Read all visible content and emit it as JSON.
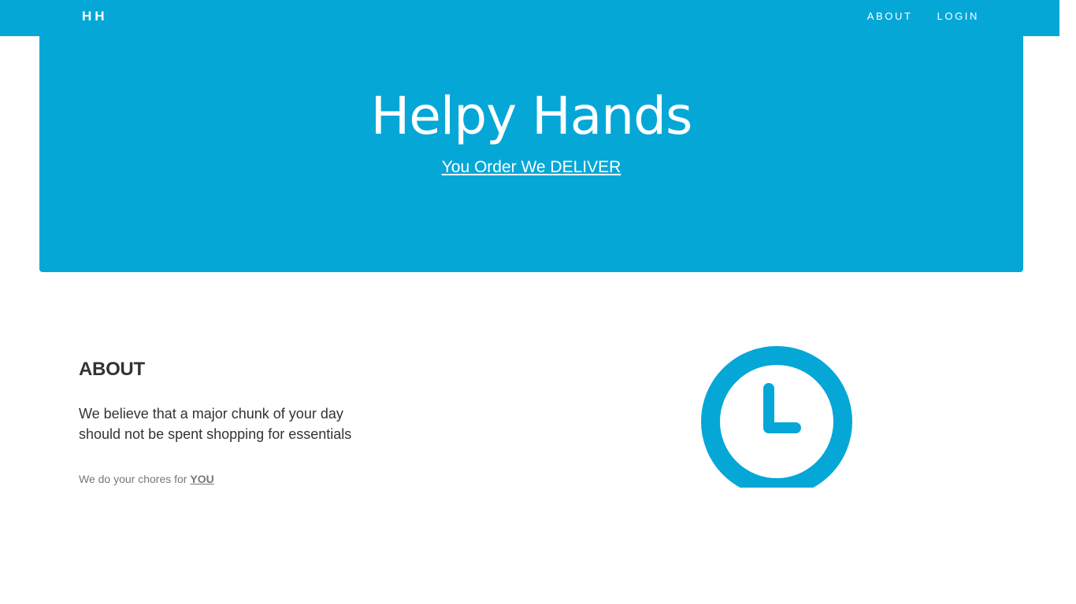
{
  "navbar": {
    "brand": "HH",
    "links": [
      {
        "label": "ABOUT"
      },
      {
        "label": "LOGIN"
      }
    ]
  },
  "hero": {
    "title": "Helpy Hands",
    "tagline": "You Order We DELIVER"
  },
  "about": {
    "heading": "ABOUT",
    "text": "We believe that a major chunk of your day should not be spent shopping for essentials",
    "sub_prefix": "We do your chores for",
    "sub_emphasis": "YOU",
    "icon": "clock-icon"
  },
  "colors": {
    "brand": "#05a7d7",
    "text": "#333333",
    "muted": "#777777"
  }
}
